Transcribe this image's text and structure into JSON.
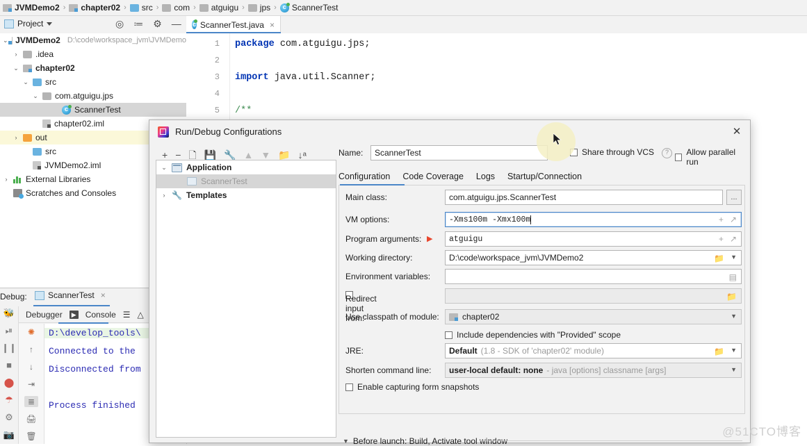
{
  "breadcrumb": [
    {
      "label": "JVMDemo2",
      "icon": "module-icon",
      "bold": true
    },
    {
      "label": "chapter02",
      "icon": "module-icon",
      "bold": true
    },
    {
      "label": "src",
      "icon": "folder-blue-icon",
      "bold": false
    },
    {
      "label": "com",
      "icon": "folder-grey-icon",
      "bold": false
    },
    {
      "label": "atguigu",
      "icon": "folder-grey-icon",
      "bold": false
    },
    {
      "label": "jps",
      "icon": "folder-grey-icon",
      "bold": false
    },
    {
      "label": "ScannerTest",
      "icon": "java-class-icon",
      "bold": false
    }
  ],
  "toolwindow": {
    "project_label": "Project",
    "icons": [
      "locate-icon",
      "collapse-all-icon",
      "gear-icon",
      "minimize-icon"
    ]
  },
  "editor": {
    "tab_label": "ScannerTest.java",
    "tab_close": "×",
    "line_numbers": [
      "1",
      "2",
      "3",
      "4",
      "5"
    ],
    "lines": [
      {
        "n": 1,
        "tokens": [
          {
            "t": "package",
            "k": "kw"
          },
          {
            "t": " com.atguigu.jps;",
            "k": "txt"
          }
        ]
      },
      {
        "n": 2,
        "tokens": []
      },
      {
        "n": 3,
        "tokens": [
          {
            "t": "import",
            "k": "kw"
          },
          {
            "t": " java.util.Scanner;",
            "k": "txt"
          }
        ]
      },
      {
        "n": 4,
        "tokens": []
      },
      {
        "n": 5,
        "tokens": [
          {
            "t": "/**",
            "k": "cm"
          }
        ]
      }
    ]
  },
  "project_tree": [
    {
      "label": "JVMDemo2",
      "path": "D:\\code\\workspace_jvm\\JVMDemo",
      "arrow": "⌄",
      "icon": "module-icon",
      "bold": true,
      "indent": 4,
      "state": "normal"
    },
    {
      "label": ".idea",
      "path": "",
      "arrow": "›",
      "icon": "folder-grey-icon",
      "bold": false,
      "indent": 18,
      "state": "normal"
    },
    {
      "label": "chapter02",
      "path": "",
      "arrow": "⌄",
      "icon": "module-icon",
      "bold": true,
      "indent": 18,
      "state": "normal"
    },
    {
      "label": "src",
      "path": "",
      "arrow": "⌄",
      "icon": "folder-blue-icon",
      "bold": false,
      "indent": 32,
      "state": "normal"
    },
    {
      "label": "com.atguigu.jps",
      "path": "",
      "arrow": "⌄",
      "icon": "folder-grey-icon",
      "bold": false,
      "indent": 46,
      "state": "normal"
    },
    {
      "label": "ScannerTest",
      "path": "",
      "arrow": "",
      "icon": "java-class-icon",
      "bold": false,
      "indent": 74,
      "state": "selected"
    },
    {
      "label": "chapter02.iml",
      "path": "",
      "arrow": "",
      "icon": "iml-icon",
      "bold": false,
      "indent": 46,
      "state": "normal"
    },
    {
      "label": "out",
      "path": "",
      "arrow": "›",
      "icon": "folder-orange-icon",
      "bold": false,
      "indent": 18,
      "state": "highlight"
    },
    {
      "label": "src",
      "path": "",
      "arrow": "",
      "icon": "folder-blue-icon",
      "bold": false,
      "indent": 32,
      "state": "normal"
    },
    {
      "label": "JVMDemo2.iml",
      "path": "",
      "arrow": "",
      "icon": "iml-icon",
      "bold": false,
      "indent": 32,
      "state": "normal"
    },
    {
      "label": "External Libraries",
      "path": "",
      "arrow": "›",
      "icon": "libraries-icon",
      "bold": false,
      "indent": 4,
      "state": "normal"
    },
    {
      "label": "Scratches and Consoles",
      "path": "",
      "arrow": "",
      "icon": "scratches-icon",
      "bold": false,
      "indent": 4,
      "state": "normal"
    }
  ],
  "debug_panel": {
    "title": "Debug:",
    "tab_label": "ScannerTest",
    "tab_close": "×",
    "subtabs": [
      "Debugger",
      "Console"
    ],
    "left_icons": [
      "bug-icon",
      "resume-icon",
      "pause-icon",
      "stop-icon",
      "breakpoints-icon",
      "mute-breakpoints-icon",
      "settings-icon",
      "screenshot-icon"
    ],
    "gutter_icons": [
      "rerun-icon",
      "up-icon",
      "down-icon",
      "soft-wrap-icon",
      "scroll-to-end-icon",
      "print-icon",
      "clear-all-icon"
    ],
    "console_lines": [
      "D:\\develop_tools\\",
      "Connected to the ",
      "Disconnected from",
      "",
      "Process finished "
    ]
  },
  "dialog": {
    "title": "Run/Debug Configurations",
    "close_label": "✕",
    "toolbar_icons": [
      "add-icon",
      "remove-icon",
      "copy-icon",
      "save-icon",
      "edit-templates-icon",
      "move-up-icon",
      "move-down-icon",
      "new-folder-icon",
      "sort-icon"
    ],
    "tree": [
      {
        "label": "Application",
        "icon": "application-icon",
        "arrow": "⌄",
        "indent": 6,
        "state": "normal",
        "bold": true
      },
      {
        "label": "ScannerTest",
        "icon": "config-icon",
        "arrow": "",
        "indent": 28,
        "state": "selected",
        "bold": false
      },
      {
        "label": "Templates",
        "icon": "wrench-icon",
        "arrow": "›",
        "indent": 6,
        "state": "normal",
        "bold": true
      }
    ],
    "name_label": "Name:",
    "name_value": "ScannerTest",
    "share_vcs_label": "Share through VCS",
    "help_icon": "?",
    "allow_parallel_label": "Allow parallel run",
    "tabs": [
      "Configuration",
      "Code Coverage",
      "Logs",
      "Startup/Connection"
    ],
    "active_tab": "Configuration",
    "fields": {
      "main_class_label": "Main class:",
      "main_class_value": "com.atguigu.jps.ScannerTest",
      "browse_label": "...",
      "vm_options_label": "VM options:",
      "vm_options_value": "-Xms100m -Xmx100m",
      "program_args_label": "Program arguments:",
      "program_args_value": "atguigu",
      "working_dir_label": "Working directory:",
      "working_dir_value": "D:\\code\\workspace_jvm\\JVMDemo2",
      "env_vars_label": "Environment variables:",
      "env_vars_value": "",
      "redirect_input_label": "Redirect input from:",
      "redirect_input_value": "",
      "classpath_label": "Use classpath of module:",
      "classpath_value": "chapter02",
      "include_deps_label": "Include dependencies with \"Provided\" scope",
      "jre_label": "JRE:",
      "jre_value": "Default",
      "jre_hint": "(1.8 - SDK of 'chapter02' module)",
      "shorten_label": "Shorten command line:",
      "shorten_value": "user-local default: none",
      "shorten_hint": "- java [options] classname [args]",
      "snapshots_label": "Enable capturing form snapshots"
    },
    "before_launch": "Before launch: Build, Activate tool window"
  },
  "annotations": {
    "arrow_color": "#f03b2d",
    "cursor_highlight_color": "#f5f0c4"
  },
  "watermark": "@51CTO博客"
}
